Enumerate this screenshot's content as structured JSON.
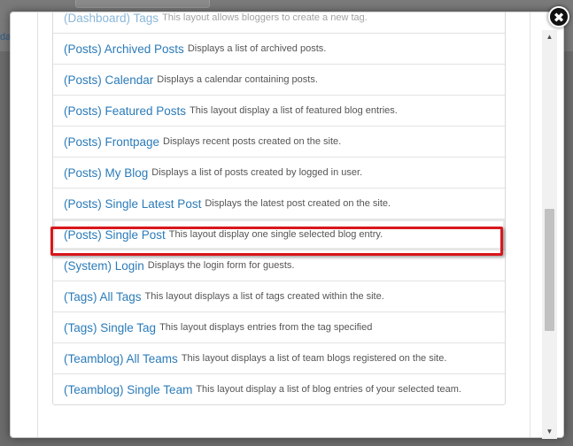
{
  "background": {
    "fragment_text": "da"
  },
  "close_button": {
    "icon": "close-icon",
    "glyph": "✖"
  },
  "layouts": [
    {
      "title": "(Dashboard) Tags",
      "desc": "This layout allows bloggers to create a new tag."
    },
    {
      "title": "(Posts) Archived Posts",
      "desc": "Displays a list of archived posts."
    },
    {
      "title": "(Posts) Calendar",
      "desc": "Displays a calendar containing posts."
    },
    {
      "title": "(Posts) Featured Posts",
      "desc": "This layout display a list of featured blog entries."
    },
    {
      "title": "(Posts) Frontpage",
      "desc": "Displays recent posts created on the site."
    },
    {
      "title": "(Posts) My Blog",
      "desc": "Displays a list of posts created by logged in user."
    },
    {
      "title": "(Posts) Single Latest Post",
      "desc": "Displays the latest post created on the site."
    },
    {
      "title": "(Posts) Single Post",
      "desc": "This layout display one single selected blog entry.",
      "selected": true
    },
    {
      "title": "(System) Login",
      "desc": "Displays the login form for guests."
    },
    {
      "title": "(Tags) All Tags",
      "desc": "This layout displays a list of tags created within the site."
    },
    {
      "title": "(Tags) Single Tag",
      "desc": "This layout displays entries from the tag specified"
    },
    {
      "title": "(Teamblog) All Teams",
      "desc": "This layout displays a list of team blogs registered on the site."
    },
    {
      "title": "(Teamblog) Single Team",
      "desc": "This layout display a list of blog entries of your selected team."
    }
  ],
  "scrollbar": {
    "up_glyph": "▲",
    "down_glyph": "▼",
    "position_fraction": 0.47
  },
  "colors": {
    "link": "#2b7bb9",
    "highlight": "#d9161c"
  }
}
